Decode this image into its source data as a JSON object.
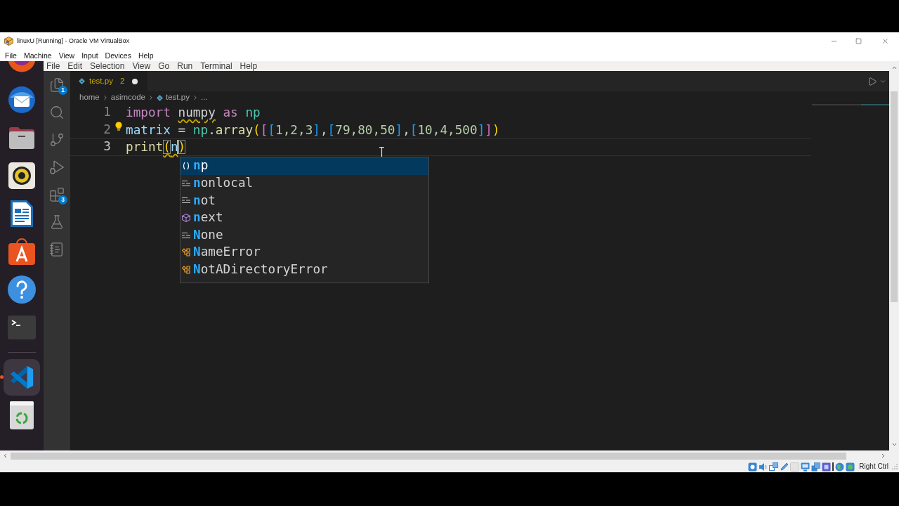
{
  "window": {
    "title": "linuxU [Running] - Oracle VM VirtualBox",
    "menu": [
      "File",
      "Machine",
      "View",
      "Input",
      "Devices",
      "Help"
    ]
  },
  "dock": {
    "groups": [
      {
        "items": [
          {
            "kind": "browser",
            "selected": false,
            "running": false
          },
          {
            "kind": "mail",
            "selected": false,
            "running": false
          },
          {
            "kind": "files",
            "selected": false,
            "running": false
          },
          {
            "kind": "music",
            "selected": false,
            "running": false
          },
          {
            "kind": "writer",
            "selected": false,
            "running": false
          },
          {
            "kind": "software",
            "selected": false,
            "running": false
          },
          {
            "kind": "help",
            "selected": false,
            "running": false
          },
          {
            "kind": "terminal",
            "selected": false,
            "running": false
          }
        ]
      },
      {
        "items": [
          {
            "kind": "code",
            "selected": true,
            "running": true
          },
          {
            "kind": "trash",
            "selected": false,
            "running": false
          }
        ]
      }
    ]
  },
  "vscode": {
    "menu": [
      "File",
      "Edit",
      "Selection",
      "View",
      "Go",
      "Run",
      "Terminal",
      "Help"
    ],
    "activity_bar": [
      {
        "kind": "explorer",
        "badge": "1"
      },
      {
        "kind": "search"
      },
      {
        "kind": "source_control"
      },
      {
        "kind": "run_debug"
      },
      {
        "kind": "extensions",
        "badge": "3"
      },
      {
        "kind": "testing"
      },
      {
        "kind": "notebook"
      }
    ],
    "tabs": [
      {
        "label": "test.py",
        "problems": "2",
        "modified": true,
        "selected": true
      }
    ],
    "breadcrumbs": [
      {
        "label": "home",
        "kind": "folder"
      },
      {
        "label": "asimcode",
        "kind": "folder"
      },
      {
        "label": "test.py",
        "kind": "file"
      },
      {
        "label": "...",
        "kind": "more"
      }
    ],
    "editor": {
      "lines": [
        {
          "number": "1",
          "current": false,
          "lightbulb": false,
          "tokens": [
            {
              "text": "import ",
              "kind": "keyword"
            },
            {
              "text": "numpy",
              "kind": "plain",
              "warning": true
            },
            {
              "text": " as ",
              "kind": "keyword"
            },
            {
              "text": "np",
              "kind": "namespace"
            }
          ]
        },
        {
          "number": "2",
          "current": false,
          "lightbulb": true,
          "tokens": [
            {
              "text": "matrix",
              "kind": "variable"
            },
            {
              "text": " = ",
              "kind": "plain"
            },
            {
              "text": "np",
              "kind": "namespace"
            },
            {
              "text": ".",
              "kind": "plain"
            },
            {
              "text": "array",
              "kind": "function"
            },
            {
              "text": "(",
              "kind": "bracket1"
            },
            {
              "text": "[",
              "kind": "bracket2"
            },
            {
              "text": "[",
              "kind": "bracket3"
            },
            {
              "text": "1,2,3",
              "kind": "number"
            },
            {
              "text": "]",
              "kind": "bracket3"
            },
            {
              "text": ",",
              "kind": "plain"
            },
            {
              "text": "[",
              "kind": "bracket3"
            },
            {
              "text": "79,80,50",
              "kind": "number"
            },
            {
              "text": "]",
              "kind": "bracket3"
            },
            {
              "text": ",",
              "kind": "plain"
            },
            {
              "text": "[",
              "kind": "bracket3"
            },
            {
              "text": "10,4,500",
              "kind": "number"
            },
            {
              "text": "]",
              "kind": "bracket3"
            },
            {
              "text": "]",
              "kind": "bracket2"
            },
            {
              "text": ")",
              "kind": "bracket1"
            }
          ]
        },
        {
          "number": "3",
          "current": true,
          "lightbulb": false,
          "tokens": [
            {
              "text": "print",
              "kind": "function"
            },
            {
              "text": "(",
              "kind": "bracket1",
              "bracket_match": true,
              "warning": true
            },
            {
              "text": "n",
              "kind": "variable",
              "warning": true,
              "caret": true
            },
            {
              "text": ")",
              "kind": "bracket1",
              "bracket_match": true
            }
          ]
        }
      ]
    },
    "suggestions": [
      {
        "label": "**n**p",
        "kind": "variable",
        "selected": true
      },
      {
        "label": "**n**onlocal",
        "kind": "keyword",
        "selected": false
      },
      {
        "label": "**n**ot",
        "kind": "keyword",
        "selected": false
      },
      {
        "label": "**n**ext",
        "kind": "method",
        "selected": false
      },
      {
        "label": "**N**one",
        "kind": "keyword",
        "selected": false
      },
      {
        "label": "**N**ameError",
        "kind": "class",
        "selected": false
      },
      {
        "label": "**N**otADirectoryError",
        "kind": "class",
        "selected": false
      }
    ]
  },
  "status_bar": {
    "host_key": "Right Ctrl"
  }
}
